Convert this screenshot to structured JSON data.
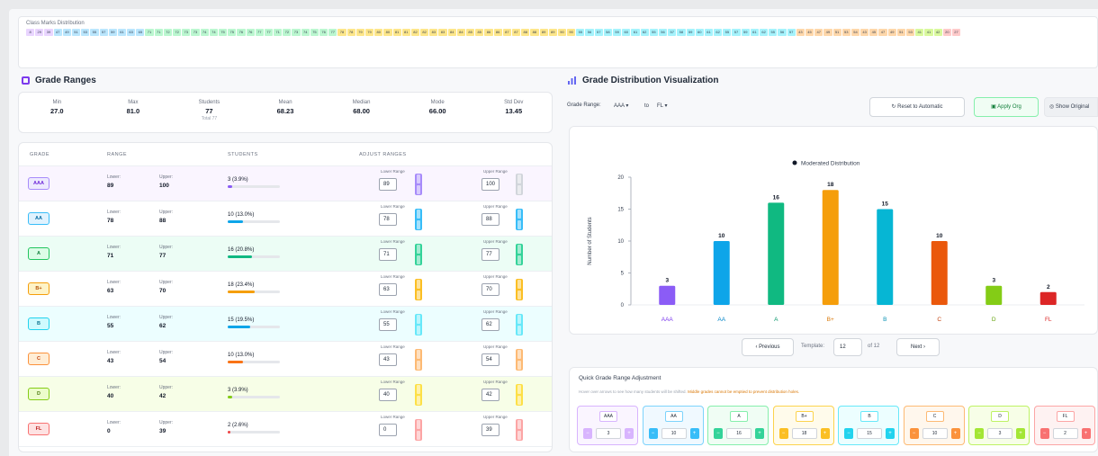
{
  "distribution": {
    "title": "Class Marks Distribution",
    "cells": [
      {
        "label": "8",
        "color": "#e9d5ff"
      },
      {
        "label": "29",
        "color": "#e9d5ff"
      },
      {
        "label": "39",
        "color": "#e9d5ff"
      },
      {
        "label": "47",
        "color": "#bae6fd"
      },
      {
        "label": "49",
        "color": "#bae6fd"
      },
      {
        "label": "51",
        "color": "#bae6fd"
      },
      {
        "label": "53",
        "color": "#bae6fd"
      },
      {
        "label": "55",
        "color": "#bae6fd"
      },
      {
        "label": "57",
        "color": "#bae6fd"
      },
      {
        "label": "59",
        "color": "#bae6fd"
      },
      {
        "label": "61",
        "color": "#bae6fd"
      },
      {
        "label": "63",
        "color": "#bae6fd"
      },
      {
        "label": "65",
        "color": "#bae6fd"
      },
      {
        "label": "71",
        "color": "#bbf7d0"
      },
      {
        "label": "71",
        "color": "#bbf7d0"
      },
      {
        "label": "72",
        "color": "#bbf7d0"
      },
      {
        "label": "72",
        "color": "#bbf7d0"
      },
      {
        "label": "73",
        "color": "#bbf7d0"
      },
      {
        "label": "73",
        "color": "#bbf7d0"
      },
      {
        "label": "74",
        "color": "#bbf7d0"
      },
      {
        "label": "74",
        "color": "#bbf7d0"
      },
      {
        "label": "75",
        "color": "#bbf7d0"
      },
      {
        "label": "75",
        "color": "#bbf7d0"
      },
      {
        "label": "76",
        "color": "#bbf7d0"
      },
      {
        "label": "76",
        "color": "#bbf7d0"
      },
      {
        "label": "77",
        "color": "#bbf7d0"
      },
      {
        "label": "77",
        "color": "#bbf7d0"
      },
      {
        "label": "71",
        "color": "#bbf7d0"
      },
      {
        "label": "72",
        "color": "#bbf7d0"
      },
      {
        "label": "73",
        "color": "#bbf7d0"
      },
      {
        "label": "74",
        "color": "#bbf7d0"
      },
      {
        "label": "75",
        "color": "#bbf7d0"
      },
      {
        "label": "76",
        "color": "#bbf7d0"
      },
      {
        "label": "77",
        "color": "#bbf7d0"
      },
      {
        "label": "78",
        "color": "#fde68a"
      },
      {
        "label": "78",
        "color": "#fde68a"
      },
      {
        "label": "79",
        "color": "#fde68a"
      },
      {
        "label": "79",
        "color": "#fde68a"
      },
      {
        "label": "80",
        "color": "#fde68a"
      },
      {
        "label": "80",
        "color": "#fde68a"
      },
      {
        "label": "81",
        "color": "#fde68a"
      },
      {
        "label": "81",
        "color": "#fde68a"
      },
      {
        "label": "82",
        "color": "#fde68a"
      },
      {
        "label": "82",
        "color": "#fde68a"
      },
      {
        "label": "83",
        "color": "#fde68a"
      },
      {
        "label": "83",
        "color": "#fde68a"
      },
      {
        "label": "84",
        "color": "#fde68a"
      },
      {
        "label": "84",
        "color": "#fde68a"
      },
      {
        "label": "85",
        "color": "#fde68a"
      },
      {
        "label": "85",
        "color": "#fde68a"
      },
      {
        "label": "86",
        "color": "#fde68a"
      },
      {
        "label": "86",
        "color": "#fde68a"
      },
      {
        "label": "87",
        "color": "#fde68a"
      },
      {
        "label": "87",
        "color": "#fde68a"
      },
      {
        "label": "88",
        "color": "#fde68a"
      },
      {
        "label": "88",
        "color": "#fde68a"
      },
      {
        "label": "89",
        "color": "#fde68a"
      },
      {
        "label": "89",
        "color": "#fde68a"
      },
      {
        "label": "90",
        "color": "#fde68a"
      },
      {
        "label": "90",
        "color": "#fde68a"
      },
      {
        "label": "55",
        "color": "#a5f3fc"
      },
      {
        "label": "56",
        "color": "#a5f3fc"
      },
      {
        "label": "57",
        "color": "#a5f3fc"
      },
      {
        "label": "58",
        "color": "#a5f3fc"
      },
      {
        "label": "59",
        "color": "#a5f3fc"
      },
      {
        "label": "60",
        "color": "#a5f3fc"
      },
      {
        "label": "61",
        "color": "#a5f3fc"
      },
      {
        "label": "62",
        "color": "#a5f3fc"
      },
      {
        "label": "55",
        "color": "#a5f3fc"
      },
      {
        "label": "56",
        "color": "#a5f3fc"
      },
      {
        "label": "57",
        "color": "#a5f3fc"
      },
      {
        "label": "58",
        "color": "#a5f3fc"
      },
      {
        "label": "59",
        "color": "#a5f3fc"
      },
      {
        "label": "60",
        "color": "#a5f3fc"
      },
      {
        "label": "61",
        "color": "#a5f3fc"
      },
      {
        "label": "62",
        "color": "#a5f3fc"
      },
      {
        "label": "55",
        "color": "#a5f3fc"
      },
      {
        "label": "57",
        "color": "#a5f3fc"
      },
      {
        "label": "59",
        "color": "#a5f3fc"
      },
      {
        "label": "61",
        "color": "#a5f3fc"
      },
      {
        "label": "62",
        "color": "#a5f3fc"
      },
      {
        "label": "55",
        "color": "#a5f3fc"
      },
      {
        "label": "56",
        "color": "#a5f3fc"
      },
      {
        "label": "57",
        "color": "#a5f3fc"
      },
      {
        "label": "43",
        "color": "#fed7aa"
      },
      {
        "label": "45",
        "color": "#fed7aa"
      },
      {
        "label": "47",
        "color": "#fed7aa"
      },
      {
        "label": "49",
        "color": "#fed7aa"
      },
      {
        "label": "51",
        "color": "#fed7aa"
      },
      {
        "label": "53",
        "color": "#fed7aa"
      },
      {
        "label": "54",
        "color": "#fed7aa"
      },
      {
        "label": "43",
        "color": "#fed7aa"
      },
      {
        "label": "45",
        "color": "#fed7aa"
      },
      {
        "label": "47",
        "color": "#fed7aa"
      },
      {
        "label": "49",
        "color": "#fed7aa"
      },
      {
        "label": "51",
        "color": "#fed7aa"
      },
      {
        "label": "53",
        "color": "#fed7aa"
      },
      {
        "label": "41",
        "color": "#d9f99d"
      },
      {
        "label": "41",
        "color": "#d9f99d"
      },
      {
        "label": "42",
        "color": "#d9f99d"
      },
      {
        "label": "20",
        "color": "#fecaca"
      },
      {
        "label": "27",
        "color": "#fecaca"
      }
    ]
  },
  "left": {
    "title": "Grade Ranges",
    "stats": [
      {
        "label": "Min",
        "value": "27.0",
        "sub": ""
      },
      {
        "label": "Max",
        "value": "81.0",
        "sub": ""
      },
      {
        "label": "Students",
        "value": "77",
        "sub": "Total 77"
      },
      {
        "label": "Mean",
        "value": "68.23",
        "sub": ""
      },
      {
        "label": "Median",
        "value": "68.00",
        "sub": ""
      },
      {
        "label": "Mode",
        "value": "66.00",
        "sub": ""
      },
      {
        "label": "Std Dev",
        "value": "13.45",
        "sub": ""
      }
    ],
    "headers": {
      "grade": "GRADE",
      "range": "RANGE",
      "students": "STUDENTS",
      "adjust": "ADJUST RANGES"
    },
    "lower_label": "Lower:",
    "upper_label": "Upper:",
    "lower_range_label": "Lower Range",
    "upper_range_label": "Upper Range",
    "rows": [
      {
        "grade": "AAA",
        "lower": "89",
        "upper": "100",
        "count": "3 (3.9%)",
        "pct": 0.039,
        "lower_in": "89",
        "upper_in": "100",
        "bg": "#faf5ff",
        "badge_bg": "#ede9fe",
        "badge_border": "#a78bfa",
        "badge_color": "#6d28d9",
        "bar": "#8b5cf6",
        "spin": "#a78bfa",
        "spin_upper": "#d1d5db"
      },
      {
        "grade": "AA",
        "lower": "78",
        "upper": "88",
        "count": "10 (13.0%)",
        "pct": 0.13,
        "lower_in": "78",
        "upper_in": "88",
        "bg": "#ffffff",
        "badge_bg": "#e0f2fe",
        "badge_border": "#38bdf8",
        "badge_color": "#0369a1",
        "bar": "#0ea5e9",
        "spin": "#38bdf8",
        "spin_upper": "#38bdf8"
      },
      {
        "grade": "A",
        "lower": "71",
        "upper": "77",
        "count": "16 (20.8%)",
        "pct": 0.208,
        "lower_in": "71",
        "upper_in": "77",
        "bg": "#ecfdf5",
        "badge_bg": "#dcfce7",
        "badge_border": "#22c55e",
        "badge_color": "#15803d",
        "bar": "#10b981",
        "spin": "#34d399",
        "spin_upper": "#34d399"
      },
      {
        "grade": "B+",
        "lower": "63",
        "upper": "70",
        "count": "18 (23.4%)",
        "pct": 0.234,
        "lower_in": "63",
        "upper_in": "70",
        "bg": "#ffffff",
        "badge_bg": "#fef3c7",
        "badge_border": "#f59e0b",
        "badge_color": "#b45309",
        "bar": "#f59e0b",
        "spin": "#fbbf24",
        "spin_upper": "#fbbf24"
      },
      {
        "grade": "B",
        "lower": "55",
        "upper": "62",
        "count": "15 (19.5%)",
        "pct": 0.195,
        "lower_in": "55",
        "upper_in": "62",
        "bg": "#ecfeff",
        "badge_bg": "#cffafe",
        "badge_border": "#22d3ee",
        "badge_color": "#0e7490",
        "bar": "#0ea5e9",
        "spin": "#67e8f9",
        "spin_upper": "#67e8f9"
      },
      {
        "grade": "C",
        "lower": "43",
        "upper": "54",
        "count": "10 (13.0%)",
        "pct": 0.13,
        "lower_in": "43",
        "upper_in": "54",
        "bg": "#ffffff",
        "badge_bg": "#ffedd5",
        "badge_border": "#fb923c",
        "badge_color": "#c2410c",
        "bar": "#f97316",
        "spin": "#fdba74",
        "spin_upper": "#fdba74"
      },
      {
        "grade": "D",
        "lower": "40",
        "upper": "42",
        "count": "3 (3.9%)",
        "pct": 0.039,
        "lower_in": "40",
        "upper_in": "42",
        "bg": "#f7fee7",
        "badge_bg": "#ecfccb",
        "badge_border": "#84cc16",
        "badge_color": "#4d7c0f",
        "bar": "#84cc16",
        "spin": "#fde047",
        "spin_upper": "#fde047"
      },
      {
        "grade": "FL",
        "lower": "0",
        "upper": "39",
        "count": "2 (2.6%)",
        "pct": 0.026,
        "lower_in": "0",
        "upper_in": "39",
        "bg": "#ffffff",
        "badge_bg": "#fee2e2",
        "badge_border": "#f87171",
        "badge_color": "#b91c1c",
        "bar": "#ef4444",
        "spin": "#fca5a5",
        "spin_upper": "#fca5a5"
      }
    ]
  },
  "right": {
    "title": "Grade Distribution Visualization",
    "grade_range_label": "Grade Range:",
    "range_from": "AAA",
    "range_to_word": "to",
    "range_to": "FL",
    "reset_button": "Reset to Automatic",
    "apply_button": "Apply Org",
    "show_original_button": "Show Original",
    "pager": {
      "prev": "Previous",
      "template_label": "Template:",
      "current": "12",
      "of": "of 12",
      "next": "Next"
    },
    "quick": {
      "title": "Quick Grade Range Adjustment",
      "hint": "Hover over arrows to see how many students will be shifted.",
      "hint_warn": "Middle grades cannot be emptied to prevent distribution holes.",
      "cards": [
        {
          "grade": "AAA",
          "value": "3",
          "bg": "#faf5ff",
          "border": "#d8b4fe",
          "btn": "#d8b4fe"
        },
        {
          "grade": "AA",
          "value": "10",
          "bg": "#f0f9ff",
          "border": "#7dd3fc",
          "btn": "#38bdf8"
        },
        {
          "grade": "A",
          "value": "16",
          "bg": "#f0fdf4",
          "border": "#86efac",
          "btn": "#34d399"
        },
        {
          "grade": "B+",
          "value": "18",
          "bg": "#fffbeb",
          "border": "#fcd34d",
          "btn": "#fbbf24"
        },
        {
          "grade": "B",
          "value": "15",
          "bg": "#ecfeff",
          "border": "#67e8f9",
          "btn": "#22d3ee"
        },
        {
          "grade": "C",
          "value": "10",
          "bg": "#fff7ed",
          "border": "#fdba74",
          "btn": "#fb923c"
        },
        {
          "grade": "D",
          "value": "3",
          "bg": "#f7fee7",
          "border": "#bef264",
          "btn": "#a3e635"
        },
        {
          "grade": "FL",
          "value": "2",
          "bg": "#fef2f2",
          "border": "#fca5a5",
          "btn": "#f87171"
        }
      ]
    }
  },
  "chart_data": {
    "type": "bar",
    "title": "",
    "legend": [
      "Moderated Distribution"
    ],
    "legend_position": "top-center",
    "categories": [
      "AAA",
      "AA",
      "A",
      "B+",
      "B",
      "C",
      "D",
      "FL"
    ],
    "values": [
      3,
      10,
      16,
      18,
      15,
      10,
      3,
      2
    ],
    "colors": [
      "#8b5cf6",
      "#0ea5e9",
      "#10b981",
      "#f59e0b",
      "#06b6d4",
      "#ea580c",
      "#84cc16",
      "#dc2626"
    ],
    "label_colors": [
      "#7c3aed",
      "#0284c7",
      "#059669",
      "#d97706",
      "#0891b2",
      "#c2410c",
      "#65a30d",
      "#dc2626"
    ],
    "xlabel": "",
    "ylabel": "Number of Students",
    "ylim": [
      0,
      20
    ],
    "yticks": [
      0,
      5,
      10,
      15,
      20
    ],
    "grid": false
  }
}
